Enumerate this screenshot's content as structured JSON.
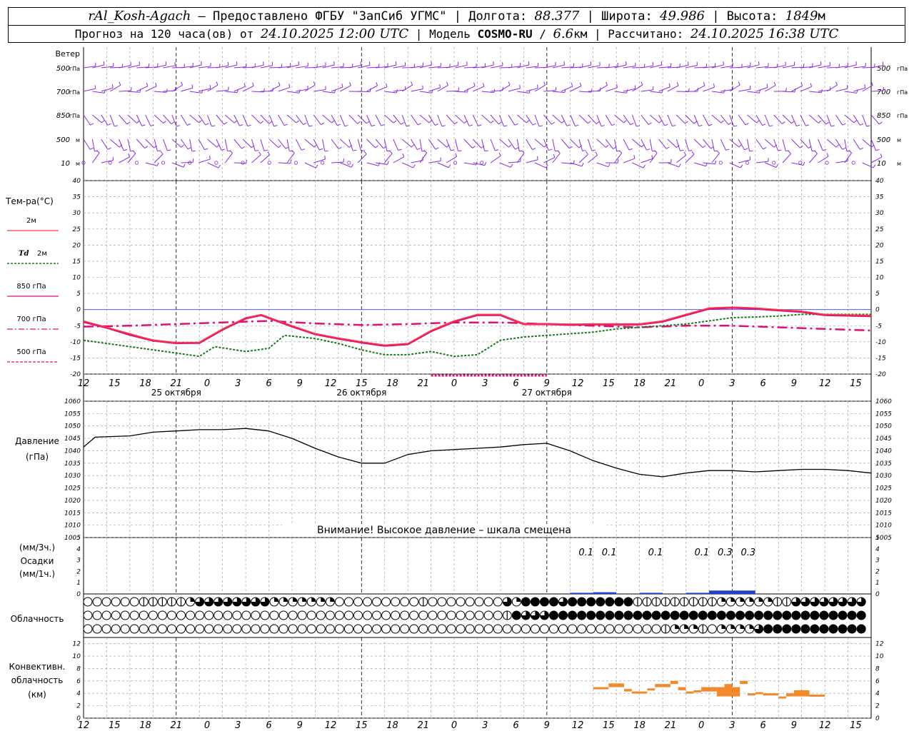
{
  "header": {
    "station": "rAl_Kosh-Agach",
    "dash": " – ",
    "provider": "Предоставлено ФГБУ \"ЗапСиб УГМС\"",
    "lon_label": "Долгота:",
    "lon_value": "88.377",
    "lat_label": "Широта:",
    "lat_value": "49.986",
    "alt_label": "Высота:",
    "alt_value": "1849",
    "alt_unit": "м",
    "forecast_prefix": "Прогноз на 120 часа(ов) от",
    "forecast_date": "24.10.2025 12:00 UTC",
    "model_label": "Модель",
    "model_name": "COSMO-RU",
    "model_res": "6.6",
    "model_res_unit": "км",
    "computed_label": "Рассчитано:",
    "computed_date": "24.10.2025 16:38 UTC"
  },
  "colors": {
    "t2m": "#ff3a3a",
    "td2m": "#1a7a1a",
    "t850": "#e0107a",
    "t700": "#e0107a",
    "t500": "#e0107a",
    "wind": "#8a2be2",
    "pressure": "#000000",
    "precip": "#1f3fd1",
    "convective": "#f28a2c",
    "zero_line": "#4040ff",
    "grid": "#999999"
  },
  "chart_data": {
    "type": "line",
    "x_hours": [
      12,
      15,
      18,
      21,
      0,
      3,
      6,
      9,
      12,
      15,
      18,
      21,
      0,
      3,
      6,
      9,
      12,
      15,
      18,
      21,
      0,
      3,
      6,
      9,
      12,
      15,
      18
    ],
    "dates": [
      "25 октября",
      "26 октября",
      "27 октября"
    ],
    "wind": {
      "label": "Ветер",
      "levels": [
        "500 гПа",
        "700 гПа",
        "850 гПа",
        "500 м",
        "10 м"
      ]
    },
    "temperature": {
      "title": "Тем-ра(°C)",
      "ylim": [
        -20,
        40
      ],
      "yticks": [
        -20,
        -15,
        -10,
        -5,
        0,
        5,
        10,
        15,
        20,
        25,
        30,
        35,
        40
      ],
      "legend": [
        {
          "key": "t2m",
          "label": "2м",
          "prefix": ""
        },
        {
          "key": "td2m",
          "label": "2м",
          "prefix": "Td"
        },
        {
          "key": "t850",
          "label": "850 гПа",
          "prefix": ""
        },
        {
          "key": "t700",
          "label": "700 гПа",
          "prefix": ""
        },
        {
          "key": "t500",
          "label": "500 гПа",
          "prefix": ""
        }
      ],
      "series": {
        "t2m": [
          [
            0,
            -3.5
          ],
          [
            3,
            -5.5
          ],
          [
            6,
            -7.5
          ],
          [
            9,
            -9.5
          ],
          [
            12,
            -10.3
          ],
          [
            15,
            -10.2
          ],
          [
            18,
            -6
          ],
          [
            21,
            -2.5
          ],
          [
            23,
            -1.6
          ],
          [
            27,
            -5
          ],
          [
            30,
            -7.5
          ],
          [
            33,
            -8.8
          ],
          [
            36,
            -10
          ],
          [
            39,
            -11
          ],
          [
            42,
            -10.5
          ],
          [
            45,
            -6.5
          ],
          [
            48,
            -3.5
          ],
          [
            51,
            -1.5
          ],
          [
            54,
            -1.5
          ],
          [
            57,
            -4.5
          ],
          [
            60,
            -4.5
          ],
          [
            63,
            -4.5
          ],
          [
            66,
            -4.5
          ],
          [
            69,
            -4.5
          ],
          [
            72,
            -4.5
          ],
          [
            75,
            -3.5
          ],
          [
            78,
            -1.5
          ],
          [
            81,
            0.5
          ],
          [
            84,
            0.8
          ],
          [
            87,
            0.5
          ],
          [
            90,
            0
          ],
          [
            93,
            -0.5
          ],
          [
            96,
            -1.5
          ],
          [
            102,
            -1.8
          ]
        ],
        "td2m": [
          [
            0,
            -9.5
          ],
          [
            3,
            -10.5
          ],
          [
            6,
            -11.5
          ],
          [
            9,
            -12.5
          ],
          [
            12,
            -13.5
          ],
          [
            15,
            -14.5
          ],
          [
            17,
            -11.5
          ],
          [
            21,
            -13
          ],
          [
            24,
            -12
          ],
          [
            26,
            -8
          ],
          [
            30,
            -9
          ],
          [
            33,
            -10.5
          ],
          [
            36,
            -12.5
          ],
          [
            39,
            -14
          ],
          [
            42,
            -14
          ],
          [
            45,
            -13
          ],
          [
            48,
            -14.5
          ],
          [
            51,
            -14
          ],
          [
            54,
            -9.5
          ],
          [
            57,
            -8.5
          ],
          [
            60,
            -8
          ],
          [
            63,
            -7.5
          ],
          [
            66,
            -7
          ],
          [
            69,
            -6
          ],
          [
            72,
            -5.5
          ],
          [
            75,
            -5
          ],
          [
            78,
            -4.5
          ],
          [
            81,
            -3.5
          ],
          [
            84,
            -2.5
          ],
          [
            87,
            -2.3
          ],
          [
            90,
            -2
          ],
          [
            93,
            -1.5
          ],
          [
            96,
            -1.5
          ],
          [
            102,
            -1.5
          ]
        ],
        "t850": [
          [
            0,
            -3.8
          ],
          [
            3,
            -5.6
          ],
          [
            6,
            -7.8
          ],
          [
            9,
            -9.6
          ],
          [
            12,
            -10.4
          ],
          [
            15,
            -10.3
          ],
          [
            18,
            -6.2
          ],
          [
            21,
            -2.7
          ],
          [
            23,
            -1.7
          ],
          [
            27,
            -5.2
          ],
          [
            30,
            -7.6
          ],
          [
            33,
            -9
          ],
          [
            36,
            -10.2
          ],
          [
            39,
            -11.2
          ],
          [
            42,
            -10.7
          ],
          [
            45,
            -6.7
          ],
          [
            48,
            -3.7
          ],
          [
            51,
            -1.7
          ],
          [
            54,
            -1.7
          ],
          [
            57,
            -4.5
          ],
          [
            60,
            -4.5
          ],
          [
            63,
            -4.7
          ],
          [
            66,
            -4.6
          ],
          [
            69,
            -4.6
          ],
          [
            72,
            -4.6
          ],
          [
            75,
            -3.7
          ],
          [
            78,
            -1.7
          ],
          [
            81,
            0.3
          ],
          [
            84,
            0.6
          ],
          [
            87,
            0.3
          ],
          [
            90,
            -0.2
          ],
          [
            93,
            -0.7
          ],
          [
            96,
            -1.7
          ],
          [
            102,
            -2
          ]
        ],
        "t700": [
          [
            0,
            -5.3
          ],
          [
            6,
            -5
          ],
          [
            12,
            -4.5
          ],
          [
            18,
            -4
          ],
          [
            24,
            -3.5
          ],
          [
            30,
            -4.3
          ],
          [
            36,
            -4.8
          ],
          [
            42,
            -4.5
          ],
          [
            48,
            -4
          ],
          [
            54,
            -4
          ],
          [
            60,
            -4.5
          ],
          [
            66,
            -5
          ],
          [
            72,
            -5.5
          ],
          [
            78,
            -5
          ],
          [
            84,
            -5
          ],
          [
            90,
            -5.5
          ],
          [
            96,
            -6
          ],
          [
            102,
            -6.5
          ]
        ],
        "t500": [
          [
            45,
            -20
          ],
          [
            60,
            -20
          ]
        ]
      }
    },
    "pressure": {
      "title": "Давление",
      "unit": "(гПа)",
      "ylim": [
        1005,
        1060
      ],
      "yticks": [
        1005,
        1010,
        1015,
        1020,
        1025,
        1030,
        1035,
        1040,
        1045,
        1050,
        1055,
        1060
      ],
      "warning": "Внимание! Высокое давление – шкала смещена",
      "series": [
        [
          0,
          1041.5
        ],
        [
          1.5,
          1045.5
        ],
        [
          6,
          1046
        ],
        [
          9,
          1047.5
        ],
        [
          12,
          1048
        ],
        [
          15,
          1048.5
        ],
        [
          18,
          1048.5
        ],
        [
          21,
          1049
        ],
        [
          24,
          1048
        ],
        [
          27,
          1045
        ],
        [
          30,
          1041
        ],
        [
          33,
          1037.5
        ],
        [
          36,
          1035
        ],
        [
          39,
          1035
        ],
        [
          42,
          1038.5
        ],
        [
          45,
          1040
        ],
        [
          51,
          1041
        ],
        [
          54,
          1041.5
        ],
        [
          57,
          1042.5
        ],
        [
          60,
          1043
        ],
        [
          63,
          1040
        ],
        [
          66,
          1036
        ],
        [
          69,
          1033
        ],
        [
          72,
          1030.5
        ],
        [
          75,
          1029.5
        ],
        [
          78,
          1031
        ],
        [
          81,
          1032
        ],
        [
          84,
          1032
        ],
        [
          87,
          1031.5
        ],
        [
          90,
          1032
        ],
        [
          93,
          1032.5
        ],
        [
          96,
          1032.5
        ],
        [
          99,
          1032
        ],
        [
          102,
          1031
        ]
      ]
    },
    "precipitation": {
      "title": "Осадки",
      "unit3": "(мм/3ч.)",
      "unit1": "(мм/1ч.)",
      "ylim": [
        0,
        5
      ],
      "yticks": [
        0,
        1,
        2,
        3,
        4,
        5
      ],
      "labels": [
        {
          "hour": 66,
          "value": "0.1"
        },
        {
          "hour": 69,
          "value": "0.1"
        },
        {
          "hour": 75,
          "value": "0.1"
        },
        {
          "hour": 81,
          "value": "0.1"
        },
        {
          "hour": 84,
          "value": "0.3"
        },
        {
          "hour": 87,
          "value": "0.3"
        }
      ],
      "bars": [
        [
          66,
          0.1
        ],
        [
          69,
          0.15
        ],
        [
          75,
          0.1
        ],
        [
          81,
          0.1
        ],
        [
          84,
          0.3
        ],
        [
          87,
          0.3
        ]
      ]
    },
    "cloudiness": {
      "title": "Облачность",
      "upper": [
        0,
        0,
        0,
        0,
        0,
        0,
        1,
        1,
        1,
        1,
        1,
        2,
        3,
        3,
        3,
        3,
        3,
        3,
        3,
        3,
        2,
        2,
        2,
        2,
        2,
        2,
        2,
        0,
        0,
        0,
        0,
        0,
        0,
        0,
        0,
        0,
        1,
        0,
        0,
        0,
        0,
        0,
        0,
        0,
        0,
        3,
        2,
        4,
        4,
        4,
        4,
        3,
        4,
        4,
        4,
        4,
        4,
        4,
        4,
        1,
        1,
        1,
        1,
        1,
        1,
        1,
        1,
        1,
        2,
        2,
        2,
        2,
        2,
        2,
        1,
        1,
        3,
        3,
        3,
        3,
        3,
        3,
        3,
        3
      ],
      "middle": [
        0,
        0,
        0,
        0,
        0,
        0,
        0,
        0,
        0,
        0,
        0,
        0,
        0,
        0,
        0,
        0,
        0,
        0,
        0,
        0,
        0,
        0,
        0,
        0,
        0,
        0,
        0,
        0,
        0,
        0,
        0,
        0,
        0,
        0,
        0,
        0,
        0,
        0,
        0,
        0,
        0,
        0,
        0,
        0,
        0,
        1,
        4,
        3,
        3,
        3,
        4,
        4,
        4,
        4,
        4,
        4,
        4,
        4,
        4,
        4,
        4,
        4,
        4,
        4,
        4,
        4,
        4,
        4,
        4,
        4,
        4,
        4,
        4,
        4,
        4,
        4,
        4,
        4,
        4,
        4,
        4,
        4,
        4,
        4
      ],
      "lower": [
        0,
        0,
        0,
        0,
        0,
        0,
        0,
        0,
        0,
        0,
        0,
        0,
        0,
        0,
        0,
        0,
        0,
        0,
        0,
        0,
        0,
        0,
        0,
        0,
        0,
        0,
        0,
        0,
        0,
        0,
        0,
        0,
        0,
        0,
        0,
        0,
        0,
        0,
        0,
        0,
        0,
        0,
        0,
        0,
        0,
        0,
        0,
        0,
        0,
        0,
        0,
        0,
        0,
        0,
        0,
        0,
        0,
        0,
        0,
        0,
        0,
        0,
        1,
        2,
        2,
        2,
        1,
        0,
        2,
        2,
        2,
        2,
        3,
        4,
        4,
        4,
        4,
        4,
        4,
        4,
        4,
        4,
        4,
        4
      ]
    },
    "convective": {
      "title": "Конвективн. облачность",
      "unit": "(км)",
      "ylim": [
        0,
        13
      ],
      "yticks": [
        0,
        2,
        4,
        6,
        8,
        10,
        12
      ],
      "segments": [
        [
          66,
          68,
          4.8,
          5
        ],
        [
          68,
          70,
          5,
          5.6
        ],
        [
          70,
          71,
          4.3,
          4.7
        ],
        [
          71,
          73,
          4,
          4.3
        ],
        [
          73,
          74,
          4.5,
          4.8
        ],
        [
          74,
          76,
          5,
          5.5
        ],
        [
          76,
          77,
          5.5,
          6
        ],
        [
          77,
          78,
          4.5,
          5
        ],
        [
          78,
          79,
          4,
          4.3
        ],
        [
          79,
          80,
          4.2,
          4.5
        ],
        [
          80,
          82,
          4.3,
          5
        ],
        [
          82,
          83,
          3.5,
          5
        ],
        [
          83,
          84,
          3.5,
          5.5
        ],
        [
          84,
          85,
          3.5,
          5
        ],
        [
          85,
          86,
          5.5,
          6
        ],
        [
          86,
          87,
          3.8,
          4
        ],
        [
          87,
          88,
          4,
          4.2
        ],
        [
          88,
          90,
          3.8,
          4
        ],
        [
          90,
          91,
          3.3,
          3.5
        ],
        [
          91,
          92,
          3.5,
          4
        ],
        [
          92,
          94,
          3.5,
          4.5
        ],
        [
          94,
          96,
          3.5,
          3.8
        ]
      ]
    }
  }
}
